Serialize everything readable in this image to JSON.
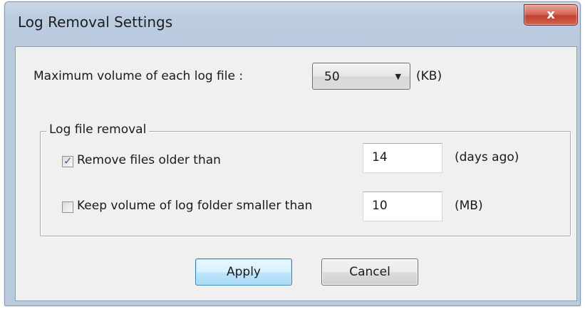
{
  "window": {
    "title": "Log Removal Settings",
    "close_label": "x"
  },
  "max_volume": {
    "label": "Maximum volume of each log file :",
    "selected_value": "50",
    "unit": "(KB)"
  },
  "log_file_removal": {
    "group_title": "Log file removal",
    "remove_older": {
      "label": "Remove files older than",
      "checked": true,
      "value": "14",
      "unit": "(days ago)"
    },
    "keep_volume": {
      "label": "Keep volume of log folder smaller than",
      "checked": false,
      "value": "10",
      "unit": "(MB)"
    }
  },
  "buttons": {
    "apply": "Apply",
    "cancel": "Cancel"
  },
  "icons": {
    "close": "close-icon",
    "dropdown": "chevron-down-icon",
    "checkmark": "checkmark-icon"
  }
}
